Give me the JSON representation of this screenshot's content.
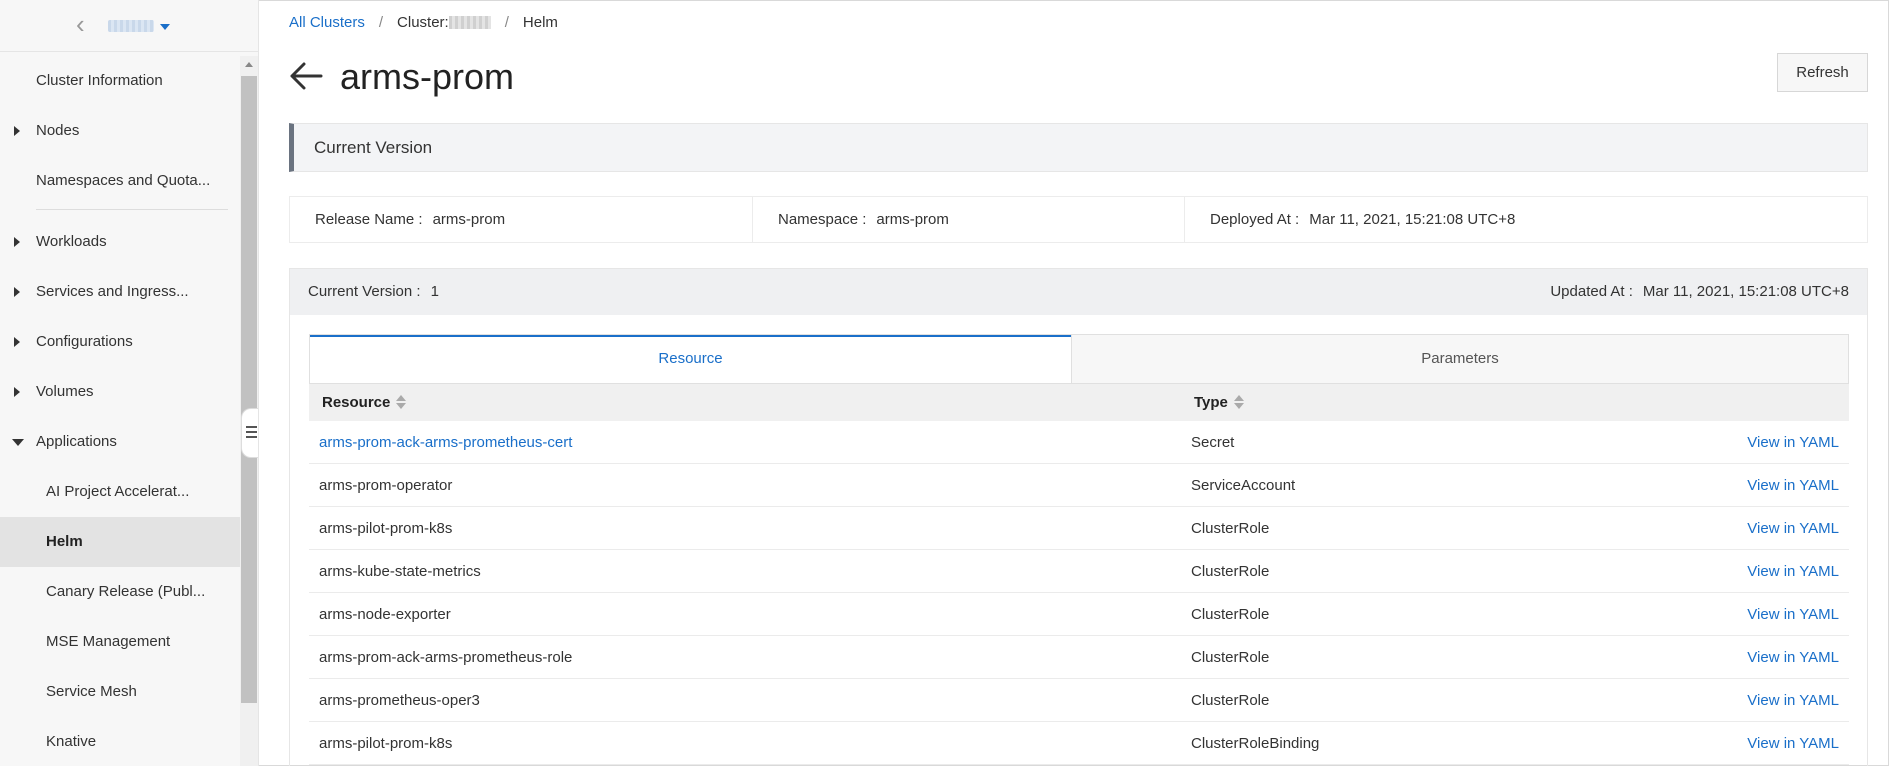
{
  "sidebar": {
    "items": [
      {
        "label": "Cluster Information",
        "expandable": false
      },
      {
        "label": "Nodes",
        "expandable": true
      },
      {
        "label": "Namespaces and Quota..."
      },
      {
        "label": "Workloads",
        "expandable": true
      },
      {
        "label": "Services and Ingress...",
        "expandable": true
      },
      {
        "label": "Configurations",
        "expandable": true
      },
      {
        "label": "Volumes",
        "expandable": true
      },
      {
        "label": "Applications",
        "expandable": true,
        "expanded": true
      },
      {
        "label": "AI Project Accelerat..."
      },
      {
        "label": "Helm",
        "active": true
      },
      {
        "label": "Canary Release (Publ..."
      },
      {
        "label": "MSE Management"
      },
      {
        "label": "Service Mesh"
      },
      {
        "label": "Knative"
      }
    ]
  },
  "breadcrumb": {
    "all_clusters": "All Clusters",
    "cluster": "Cluster:",
    "current": "Helm",
    "separator": "/"
  },
  "header": {
    "title": "arms-prom",
    "refresh_label": "Refresh"
  },
  "current_version_section": {
    "title": "Current Version",
    "release_name_label": "Release Name :",
    "release_name": "arms-prom",
    "namespace_label": "Namespace :",
    "namespace": "arms-prom",
    "deployed_at_label": "Deployed At :",
    "deployed_at": "Mar 11, 2021, 15:21:08 UTC+8"
  },
  "version_panel": {
    "current_version_label": "Current Version :",
    "current_version": "1",
    "updated_at_label": "Updated At :",
    "updated_at": "Mar 11, 2021, 15:21:08 UTC+8"
  },
  "tabs": [
    {
      "label": "Resource",
      "active": true
    },
    {
      "label": "Parameters",
      "active": false
    }
  ],
  "table": {
    "columns": [
      "Resource",
      "Type"
    ],
    "action_label": "View in YAML",
    "rows": [
      {
        "resource": "arms-prom-ack-arms-prometheus-cert",
        "type": "Secret"
      },
      {
        "resource": "arms-prom-operator",
        "type": "ServiceAccount"
      },
      {
        "resource": "arms-pilot-prom-k8s",
        "type": "ClusterRole"
      },
      {
        "resource": "arms-kube-state-metrics",
        "type": "ClusterRole"
      },
      {
        "resource": "arms-node-exporter",
        "type": "ClusterRole"
      },
      {
        "resource": "arms-prom-ack-arms-prometheus-role",
        "type": "ClusterRole"
      },
      {
        "resource": "arms-prometheus-oper3",
        "type": "ClusterRole"
      },
      {
        "resource": "arms-pilot-prom-k8s",
        "type": "ClusterRoleBinding"
      }
    ]
  },
  "colors": {
    "link": "#1a6fc9",
    "active_sidebar_bg": "#e3e3e3"
  }
}
